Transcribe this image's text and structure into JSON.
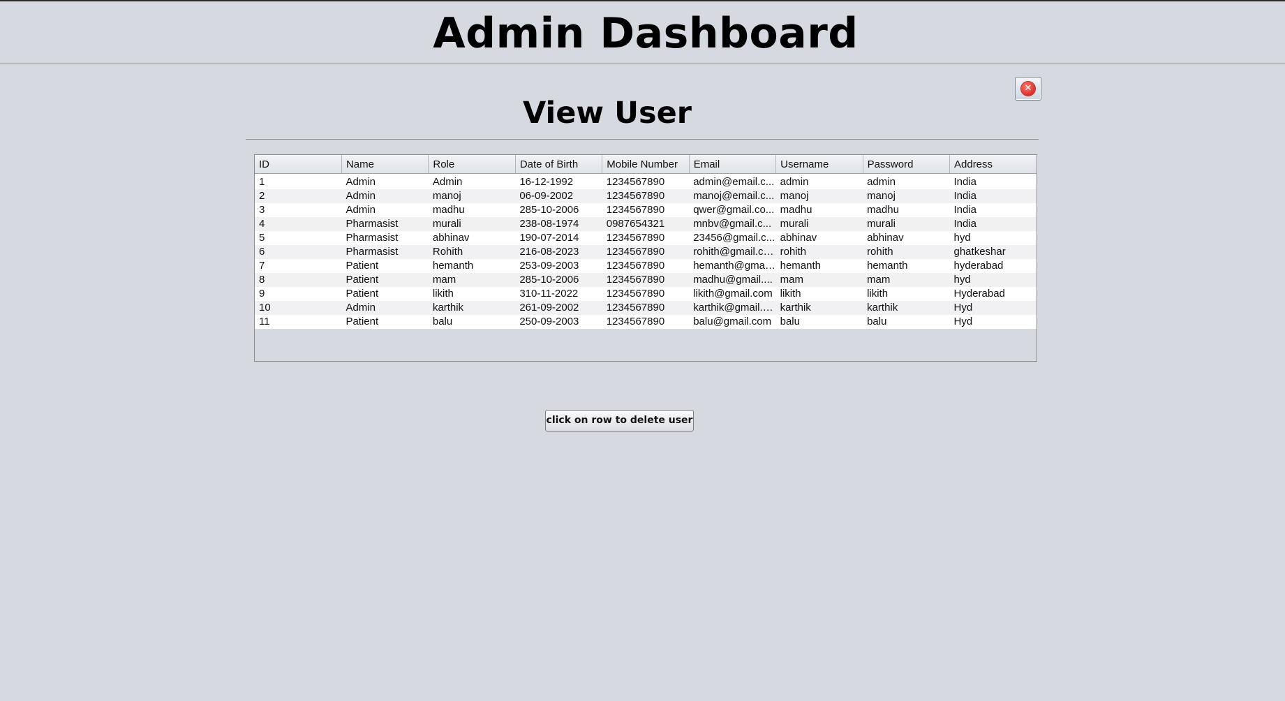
{
  "header": {
    "title": "Admin Dashboard"
  },
  "close_button": {
    "icon": "close-icon",
    "glyph": "✕",
    "color": "#d9302a"
  },
  "section": {
    "title": "View User"
  },
  "users_table": {
    "columns": [
      "ID",
      "Name",
      "Role",
      "Date of Birth",
      "Mobile Number",
      "Email",
      "Username",
      "Password",
      "Address"
    ],
    "rows": [
      [
        "1",
        "Admin",
        "Admin",
        "16-12-1992",
        "1234567890",
        "admin@email.c...",
        "admin",
        "admin",
        "India"
      ],
      [
        "2",
        "Admin",
        "manoj",
        "06-09-2002",
        "1234567890",
        "manoj@email.c...",
        "manoj",
        "manoj",
        "India"
      ],
      [
        "3",
        "Admin",
        "madhu",
        "285-10-2006",
        "1234567890",
        "qwer@gmail.co...",
        "madhu",
        "madhu",
        "India"
      ],
      [
        "4",
        "Pharmasist",
        "murali",
        "238-08-1974",
        "0987654321",
        "mnbv@gmail.c...",
        "murali",
        "murali",
        "India"
      ],
      [
        "5",
        "Pharmasist",
        "abhinav",
        "190-07-2014",
        "1234567890",
        "23456@gmail.c...",
        "abhinav",
        "abhinav",
        "hyd"
      ],
      [
        "6",
        "Pharmasist",
        "Rohith",
        "216-08-2023",
        "1234567890",
        "rohith@gmail.co...",
        "rohith",
        "rohith",
        "ghatkeshar"
      ],
      [
        "7",
        "Patient",
        "hemanth",
        "253-09-2003",
        "1234567890",
        "hemanth@gmai...",
        "hemanth",
        "hemanth",
        "hyderabad"
      ],
      [
        "8",
        "Patient",
        "mam",
        "285-10-2006",
        "1234567890",
        "madhu@gmail....",
        "mam",
        "mam",
        "hyd"
      ],
      [
        "9",
        "Patient",
        "likith",
        "310-11-2022",
        "1234567890",
        "likith@gmail.com",
        "likith",
        "likith",
        "Hyderabad"
      ],
      [
        "10",
        "Admin",
        "karthik",
        "261-09-2002",
        "1234567890",
        "karthik@gmail.c...",
        "karthik",
        "karthik",
        "Hyd"
      ],
      [
        "11",
        "Patient",
        "balu",
        "250-09-2003",
        "1234567890",
        "balu@gmail.com",
        "balu",
        "balu",
        "Hyd"
      ]
    ]
  },
  "action_button": {
    "label": "click on row to delete user"
  },
  "colors": {
    "background": "#d6d9e0",
    "row_alt": "#f1f1f3",
    "row": "#ffffff"
  }
}
